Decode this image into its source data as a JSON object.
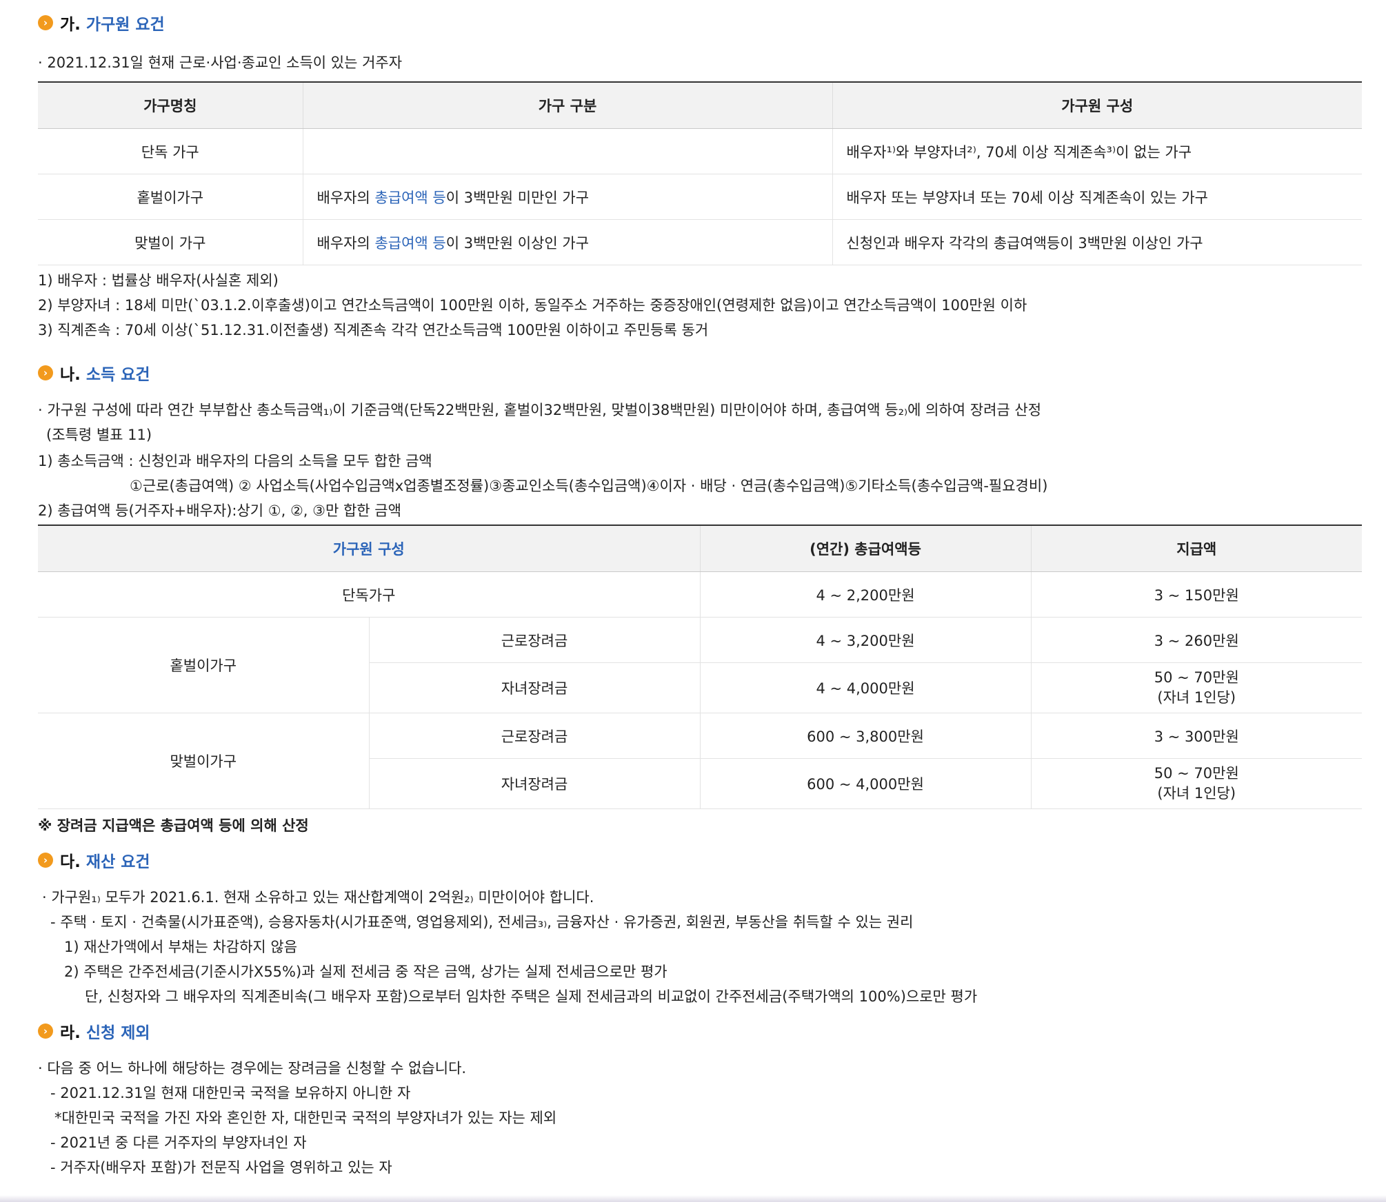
{
  "sections": {
    "a": {
      "prefix": "가.",
      "name": "가구원 요건",
      "intro": "· 2021.12.31일 현재 근로·사업·종교인 소득이 있는 거주자",
      "table": {
        "headers": [
          "가구명칭",
          "가구 구분",
          "가구원 구성"
        ],
        "rows": [
          {
            "name": "단독 가구",
            "div_pre": "",
            "div_link": "",
            "div_post": "",
            "comp": "배우자¹⁾와 부양자녀²⁾, 70세 이상 직계존속³⁾이 없는 가구"
          },
          {
            "name": "홑벌이가구",
            "div_pre": "배우자의 ",
            "div_link": "총급여액 등",
            "div_post": "이 3백만원 미만인 가구",
            "comp": "배우자 또는 부양자녀 또는 70세 이상 직계존속이 있는 가구"
          },
          {
            "name": "맞벌이 가구",
            "div_pre": "배우자의 ",
            "div_link": "총급여액 등",
            "div_post": "이 3백만원 이상인 가구",
            "comp": "신청인과 배우자 각각의 총급여액등이 3백만원 이상인 가구"
          }
        ]
      },
      "notes": [
        "1) 배우자 : 법률상 배우자(사실혼 제외)",
        "2) 부양자녀 : 18세 미만(`03.1.2.이후출생)이고 연간소득금액이 100만원 이하, 동일주소 거주하는 중증장애인(연령제한 없음)이고 연간소득금액이 100만원 이하",
        "3) 직계존속 : 70세 이상(`51.12.31.이전출생) 직계존속 각각 연간소득금액 100만원 이하이고 주민등록 동거"
      ]
    },
    "b": {
      "prefix": "나.",
      "name": "소득 요건",
      "intro1": "· 가구원 구성에 따라 연간 부부합산 총소득금액₁₎이 기준금액(단독22백만원, 홑벌이32백만원, 맞벌이38백만원) 미만이어야 하며, 총급여액 등₂₎에 의하여 장려금 산정",
      "intro2": "(조특령 별표 11)",
      "notes": [
        "1) 총소득금액 : 신청인과 배우자의 다음의 소득을 모두 합한 금액",
        "①근로(총급여액) ② 사업소득(사업수입금액x업종별조정률)③종교인소득(총수입금액)④이자 · 배당 · 연금(총수입금액)⑤기타소득(총수입금액-필요경비)",
        "2) 총급여액 등(거주자+배우자):상기 ①, ②, ③만 합한 금액"
      ],
      "table": {
        "headers": [
          "가구원 구성",
          "(연간) 총급여액등",
          "지급액"
        ],
        "single": {
          "name": "단독가구",
          "range": "4 ~ 2,200만원",
          "amount": "3 ~ 150만원"
        },
        "one_earner": {
          "name": "홑벌이가구",
          "work": {
            "type": "근로장려금",
            "range": "4 ~ 3,200만원",
            "amount": "3 ~ 260만원"
          },
          "child": {
            "type": "자녀장려금",
            "range": "4 ~ 4,000만원",
            "amount1": "50 ~ 70만원",
            "amount2": "(자녀 1인당)"
          }
        },
        "dual_earner": {
          "name": "맞벌이가구",
          "work": {
            "type": "근로장려금",
            "range": "600 ~ 3,800만원",
            "amount": "3 ~ 300만원"
          },
          "child": {
            "type": "자녀장려금",
            "range": "600 ~ 4,000만원",
            "amount1": "50 ~ 70만원",
            "amount2": "(자녀 1인당)"
          }
        }
      },
      "footnote": "※ 장려금 지급액은 총급여액 등에 의해 산정"
    },
    "c": {
      "prefix": "다.",
      "name": "재산 요건",
      "lines": [
        "· 가구원₁₎ 모두가 2021.6.1. 현재 소유하고 있는 재산합계액이 2억원₂₎ 미만이어야 합니다.",
        "- 주택 · 토지 · 건축물(시가표준액), 승용자동차(시가표준액, 영업용제외), 전세금₃₎, 금융자산 · 유가증권, 회원권, 부동산을 취득할 수 있는 권리",
        "1) 재산가액에서 부채는 차감하지 않음",
        "2) 주택은 간주전세금(기준시가X55%)과 실제 전세금 중 작은 금액, 상가는 실제 전세금으로만 평가",
        "단, 신청자와 그 배우자의 직계존비속(그 배우자 포함)으로부터 임차한 주택은 실제 전세금과의 비교없이 간주전세금(주택가액의 100%)으로만 평가"
      ]
    },
    "d": {
      "prefix": "라.",
      "name": "신청 제외",
      "lines": [
        "· 다음 중 어느 하나에 해당하는 경우에는 장려금을 신청할 수 없습니다.",
        "- 2021.12.31일 현재 대한민국 국적을 보유하지 아니한 자",
        "*대한민국 국적을 가진 자와 혼인한 자, 대한민국 국적의 부양자녀가 있는 자는 제외",
        "- 2021년 중 다른 거주자의 부양자녀인 자",
        "- 거주자(배우자 포함)가 전문직 사업을 영위하고 있는 자"
      ]
    }
  },
  "colors": {
    "accent": "#2b64b8",
    "bullet": "#f29a1d",
    "header_bg": "#f2f2f2"
  }
}
